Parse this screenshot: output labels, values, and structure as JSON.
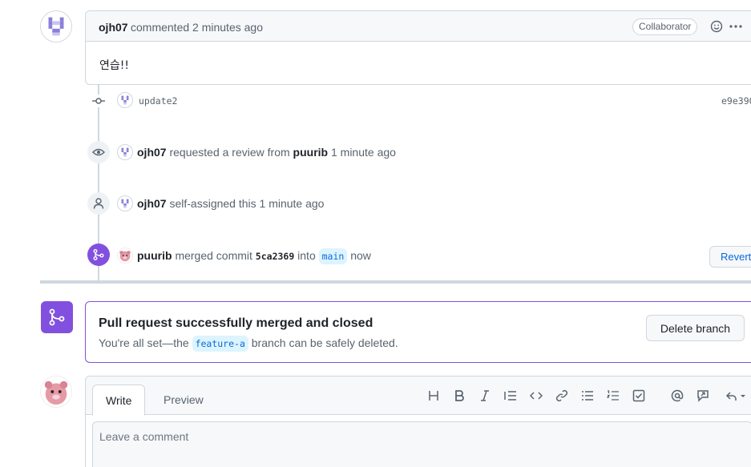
{
  "comment": {
    "author": "ojh07",
    "meta": "commented 2 minutes ago",
    "badge": "Collaborator",
    "body": "연습!!"
  },
  "commit_event": {
    "message": "update2",
    "sha": "e9e390"
  },
  "review_event": {
    "actor": "ojh07",
    "text": "requested a review from",
    "reviewer": "puurib",
    "time": "1 minute ago"
  },
  "assign_event": {
    "actor": "ojh07",
    "text": "self-assigned this 1 minute ago"
  },
  "merge_event": {
    "actor": "puurib",
    "text": "merged commit",
    "commit": "5ca2369",
    "into": "into",
    "branch": "main",
    "time": "now",
    "revert_label": "Revert"
  },
  "merged_box": {
    "title": "Pull request successfully merged and closed",
    "desc_prefix": "You're all set—the",
    "branch": "feature-a",
    "desc_suffix": "branch can be safely deleted.",
    "delete_label": "Delete branch"
  },
  "editor": {
    "tab_write": "Write",
    "tab_preview": "Preview",
    "placeholder": "Leave a comment",
    "toolbar": [
      "heading-icon",
      "bold-icon",
      "italic-icon",
      "quote-icon",
      "code-icon",
      "link-icon",
      "bulleted-list-icon",
      "numbered-list-icon",
      "task-list-icon",
      "mention-icon",
      "reference-icon",
      "reply-icon"
    ]
  },
  "colors": {
    "merged_purple": "#8250df",
    "link_blue": "#0969da",
    "border": "#d0d7de"
  }
}
